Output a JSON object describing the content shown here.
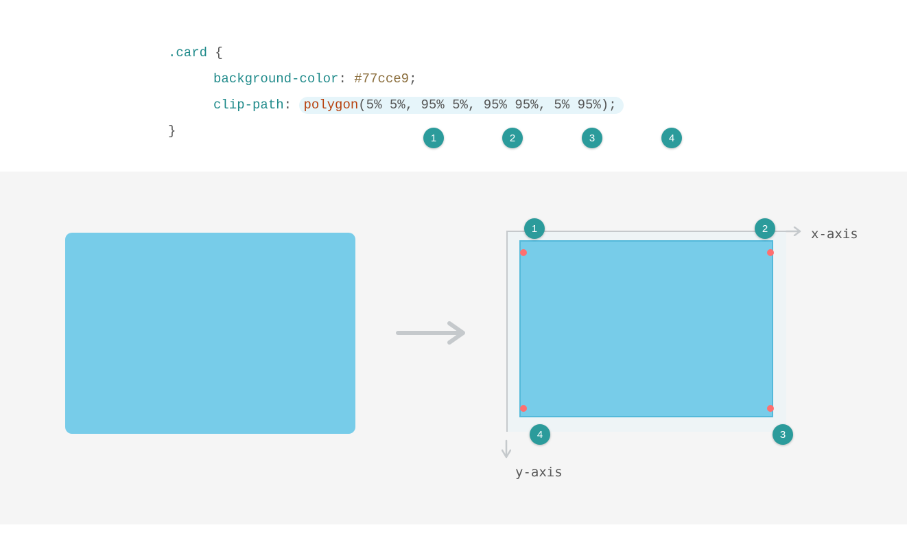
{
  "code": {
    "selector": ".card",
    "brace_open": "{",
    "brace_close": "}",
    "bg_prop": "background-color",
    "bg_value": "#77cce9",
    "clip_prop": "clip-path",
    "func_name": "polygon",
    "paren_open": "(",
    "paren_close": ")",
    "points": [
      "5% 5%",
      "95% 5%",
      "95% 95%",
      "5% 95%"
    ],
    "comma": ",",
    "colon": ":",
    "semi": ";"
  },
  "badges": {
    "b1": "1",
    "b2": "2",
    "b3": "3",
    "b4": "4"
  },
  "diagram": {
    "x_axis_label": "x-axis",
    "y_axis_label": "y-axis",
    "corner1": "1",
    "corner2": "2",
    "corner3": "3",
    "corner4": "4"
  },
  "colors": {
    "card_bg": "#77cce9",
    "badge_bg": "#2b9b9b",
    "dot": "#ff6f6f",
    "coord_bg": "#eef4f6",
    "diagram_bg": "#f5f5f5"
  }
}
